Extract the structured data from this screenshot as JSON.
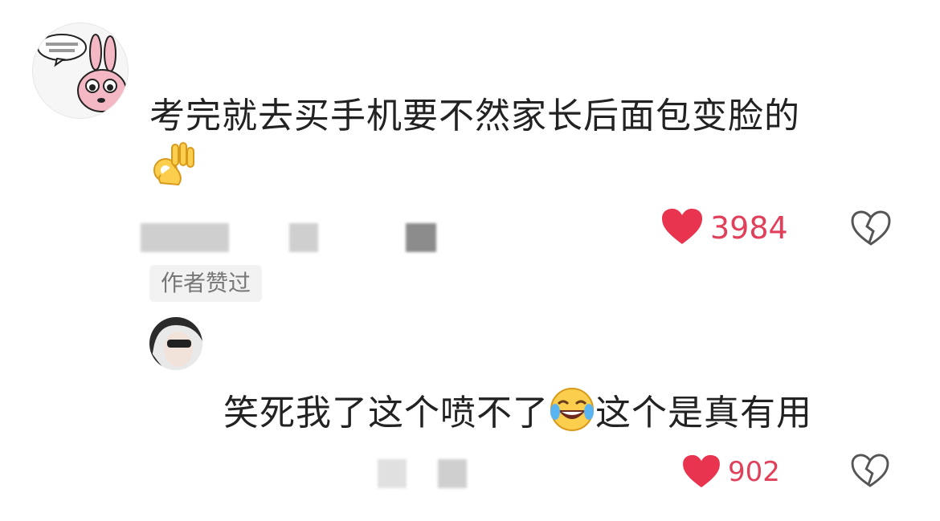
{
  "comment1": {
    "text": "考完就去买手机要不然家长后面包变脸的",
    "emoji": "ok-hand",
    "like_count": "3984",
    "author_liked": "作者赞过"
  },
  "comment2": {
    "text_part1": "笑死我了这个喷不了",
    "emoji": "rolling-on-floor-laughing",
    "text_part2": "这个是真有用",
    "like_count": "902"
  },
  "colors": {
    "heart": "#e8344f",
    "count": "#e0405a"
  }
}
